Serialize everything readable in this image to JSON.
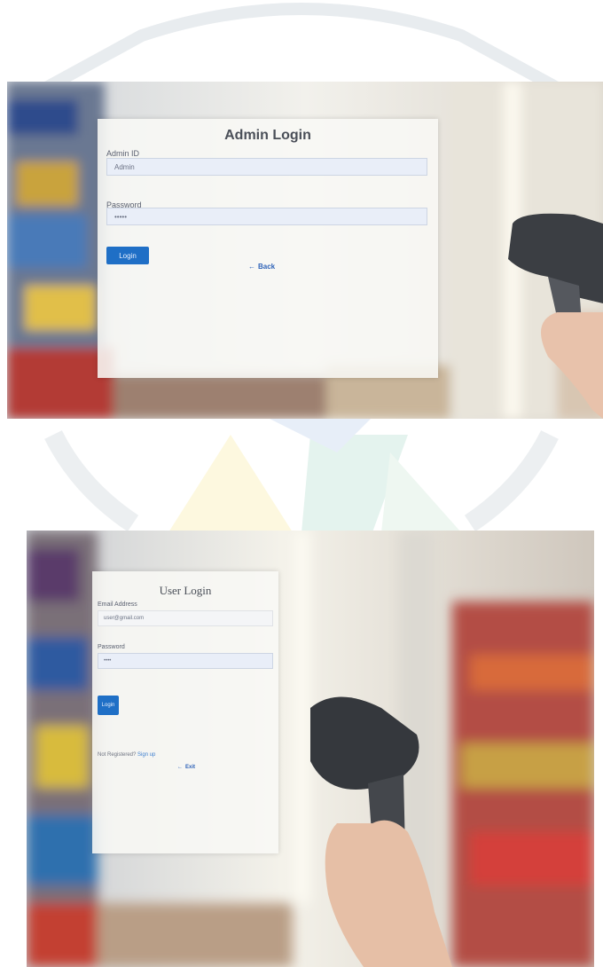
{
  "admin_login": {
    "title": "Admin Login",
    "id_label": "Admin ID",
    "id_value": "Admin",
    "password_label": "Password",
    "password_value": "•••••",
    "login_button": "Login",
    "back_link": "Back",
    "back_icon": "arrow-left-icon"
  },
  "user_login": {
    "title": "User Login",
    "email_label": "Email Address",
    "email_value": "user@gmail.com",
    "password_label": "Password",
    "password_value": "••••",
    "login_button": "Login",
    "signup_prompt": "Not Registered?",
    "signup_link": "Sign up",
    "exit_link": "Exit",
    "exit_icon": "arrow-left-icon"
  },
  "colors": {
    "primary_button": "#1f6fc6",
    "link": "#2f63b8",
    "input_bg": "#e9eef8"
  }
}
